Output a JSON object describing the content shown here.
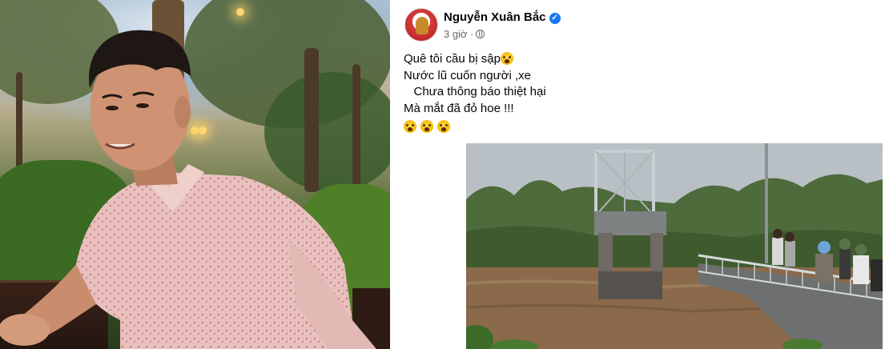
{
  "post": {
    "author": "Nguyễn Xuân Bắc",
    "time": "3 giờ",
    "separator": "·",
    "verified_icon": "verified-badge-icon",
    "privacy_icon": "globe-icon",
    "lines": [
      "Quê tôi cầu bị sập",
      "Nước lũ cuốn người ,xe",
      "   Chưa thông báo thiệt hại",
      "Mà mắt đã đỏ hoe !!!"
    ],
    "emoji_name": "crying-face-emoji",
    "accent_color": "#1877f2"
  }
}
